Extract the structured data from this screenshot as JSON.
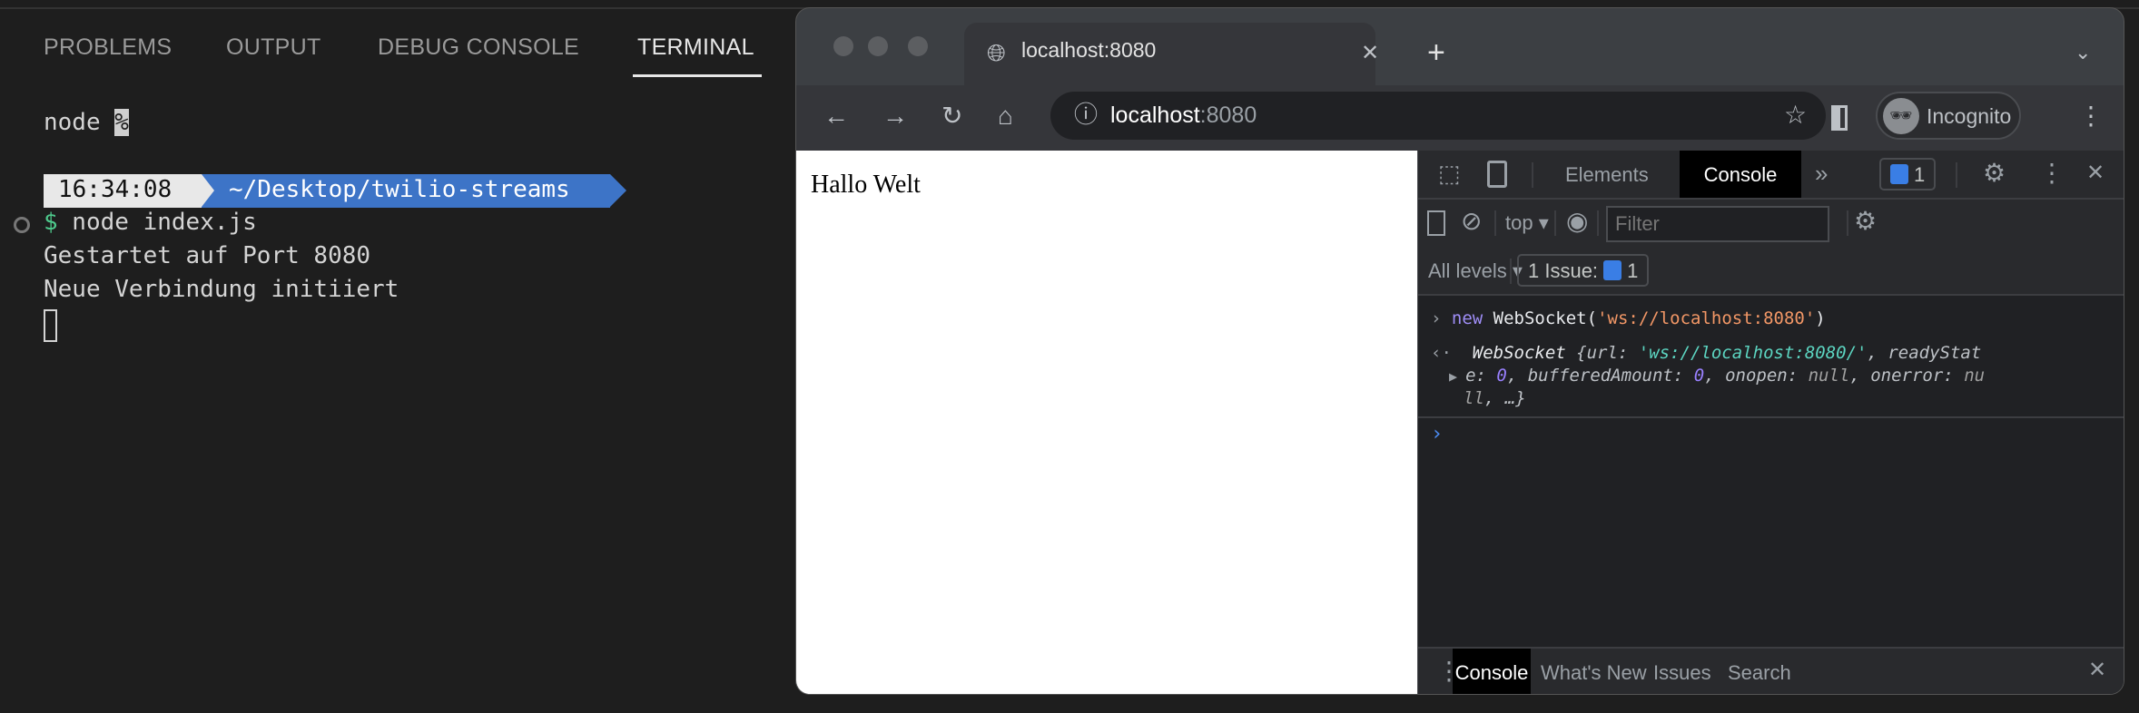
{
  "terminal_panel": {
    "tabs": [
      {
        "label": "PROBLEMS"
      },
      {
        "label": "OUTPUT"
      },
      {
        "label": "DEBUG CONSOLE"
      },
      {
        "label": "TERMINAL",
        "active": true
      }
    ],
    "lines": {
      "node_prefix": "node ",
      "node_suffix": "%",
      "prompt_time": "16:34:08",
      "prompt_path": "~/Desktop/twilio-streams",
      "prompt_symbol": "$",
      "command": " node index.js",
      "out1": "Gestartet auf Port 8080",
      "out2": "Neue Verbindung initiiert"
    },
    "prompt_colors": {
      "time_bg": "#e8e8e8",
      "path_bg": "#3d74c7",
      "dollar": "#4ec98c"
    }
  },
  "browser": {
    "tab_title": "localhost:8080",
    "url_host": "localhost",
    "url_port": ":8080",
    "profile_label": "Incognito",
    "page_text": "Hallo Welt"
  },
  "devtools": {
    "tabs": [
      {
        "label": "Elements"
      },
      {
        "label": "Console",
        "active": true
      }
    ],
    "more": "»",
    "issues_count": "1",
    "context": "top",
    "filter_placeholder": "Filter",
    "levels": "All levels",
    "issues_label": "1 Issue:",
    "issues_badge": "1",
    "console": {
      "input_kw": "new",
      "input_fn": " WebSocket(",
      "input_str": "'ws://localhost:8080'",
      "input_close": ")",
      "out_l1_a": "WebSocket ",
      "out_l1_b": "{url: ",
      "out_l1_str": "'ws://localhost:8080/'",
      "out_l1_c": ", readyStat",
      "out_l2_a": "e: ",
      "out_l2_n1": "0",
      "out_l2_b": ", bufferedAmount: ",
      "out_l2_n2": "0",
      "out_l2_c": ", onopen: ",
      "out_l2_null": "null",
      "out_l2_d": ", onerror: ",
      "out_l2_nu": "nu",
      "out_l3_ll": "ll",
      "out_l3_end": ", …}"
    },
    "drawer_tabs": [
      {
        "label": "Console",
        "active": true
      },
      {
        "label": "What's New"
      },
      {
        "label": "Issues"
      },
      {
        "label": "Search"
      }
    ]
  }
}
